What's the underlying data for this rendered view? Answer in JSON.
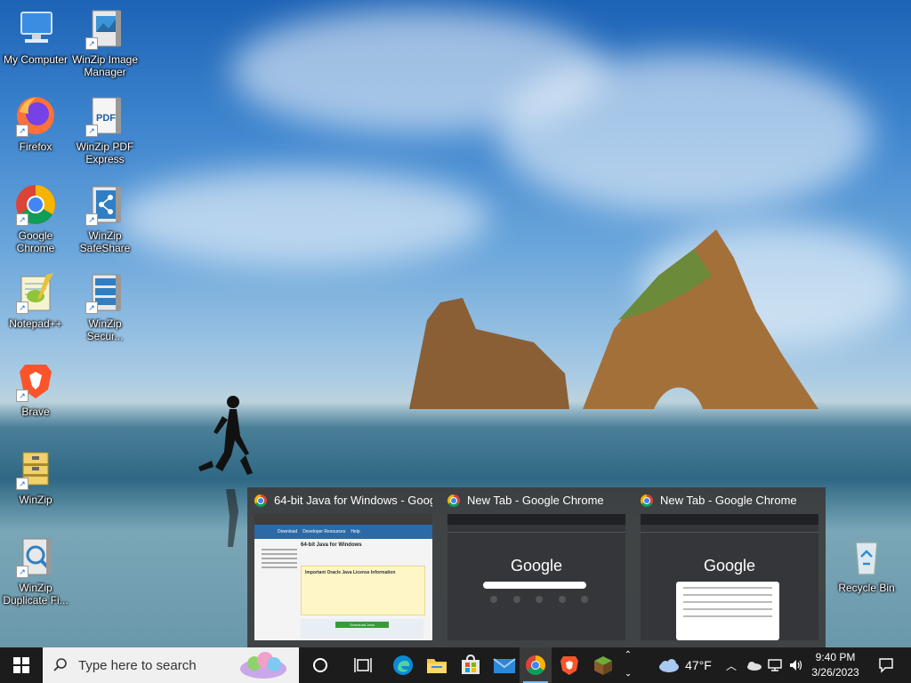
{
  "desktop_icons": [
    {
      "label": "My Computer",
      "icon": "computer-icon"
    },
    {
      "label": "WinZip Image Manager",
      "icon": "winzip-image-icon"
    },
    {
      "label": "Firefox",
      "icon": "firefox-icon"
    },
    {
      "label": "WinZip PDF Express",
      "icon": "winzip-pdf-icon"
    },
    {
      "label": "Google Chrome",
      "icon": "chrome-icon"
    },
    {
      "label": "WinZip SafeShare",
      "icon": "winzip-safeshare-icon"
    },
    {
      "label": "Notepad++",
      "icon": "notepadpp-icon"
    },
    {
      "label": "WinZip Secur...",
      "icon": "winzip-secure-icon"
    },
    {
      "label": "Brave",
      "icon": "brave-icon"
    },
    {
      "label": "WinZip",
      "icon": "winzip-icon"
    },
    {
      "label": "WinZip Duplicate Fi...",
      "icon": "winzip-duplicate-icon"
    },
    {
      "label": "Recycle Bin",
      "icon": "recycle-bin-icon"
    }
  ],
  "preview": {
    "thumbs": [
      {
        "title": "64-bit Java for Windows - Goog...",
        "page_heading": "64-bit Java for Windows",
        "nav": [
          "Download",
          "Developer Resources",
          "Help"
        ],
        "notice_title": "Important Oracle Java License Information",
        "button": "Download Java"
      },
      {
        "title": "New Tab - Google Chrome",
        "logo": "Google"
      },
      {
        "title": "New Tab - Google Chrome",
        "logo": "Google"
      }
    ]
  },
  "taskbar": {
    "search_placeholder": "Type here to search",
    "weather": "47°F",
    "time": "9:40 PM",
    "date": "3/26/2023"
  },
  "colors": {
    "taskbar": "#1c1c1c",
    "accent": "#4285f4"
  }
}
